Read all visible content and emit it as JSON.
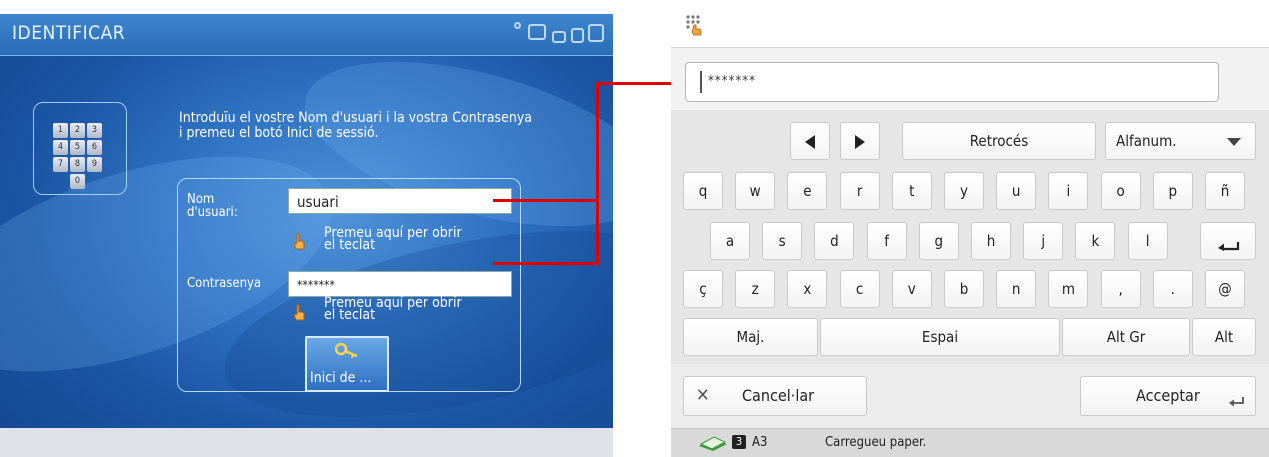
{
  "login_screen": {
    "title": "IDENTIFICAR",
    "keypad_keys": [
      "1",
      "2",
      "3",
      "4",
      "5",
      "6",
      "7",
      "8",
      "9",
      "0"
    ],
    "instructions": "Introduïu el vostre Nom d'usuari i la vostra Contrasenya i premeu el botó Inici de sessió.",
    "username_label_line1": "Nom",
    "username_label_line2": "d'usuari:",
    "username_value": "usuari",
    "username_hint_line1": "Premeu aquí per obrir",
    "username_hint_line2": "el teclat",
    "password_label": "Contrasenya",
    "password_value": "*******",
    "password_hint_line1": "Premeu aquí per obrir",
    "password_hint_line2": "el teclat",
    "login_button_label": "Inici de ..."
  },
  "keyboard_screen": {
    "password_value": "*******",
    "nav_left": "◀",
    "nav_right": "▶",
    "backspace_label": "Retrocés",
    "mode_label": "Alfanum.",
    "row1": [
      "q",
      "w",
      "e",
      "r",
      "t",
      "y",
      "u",
      "i",
      "o",
      "p",
      "ñ"
    ],
    "row2": [
      "a",
      "s",
      "d",
      "f",
      "g",
      "h",
      "j",
      "k",
      "l"
    ],
    "row3": [
      "ç",
      "z",
      "x",
      "c",
      "v",
      "b",
      "n",
      "m",
      ",",
      ".",
      "@"
    ],
    "shift_label": "Maj.",
    "space_label": "Espai",
    "altgr_label": "Alt Gr",
    "alt_label": "Alt",
    "cancel_label": "Cancel·lar",
    "accept_label": "Acceptar",
    "status_badge": "3",
    "paper_size": "A3",
    "status_message": "Carregueu paper."
  },
  "colors": {
    "connector": "#e00000",
    "login_background": "#2f72c2"
  }
}
